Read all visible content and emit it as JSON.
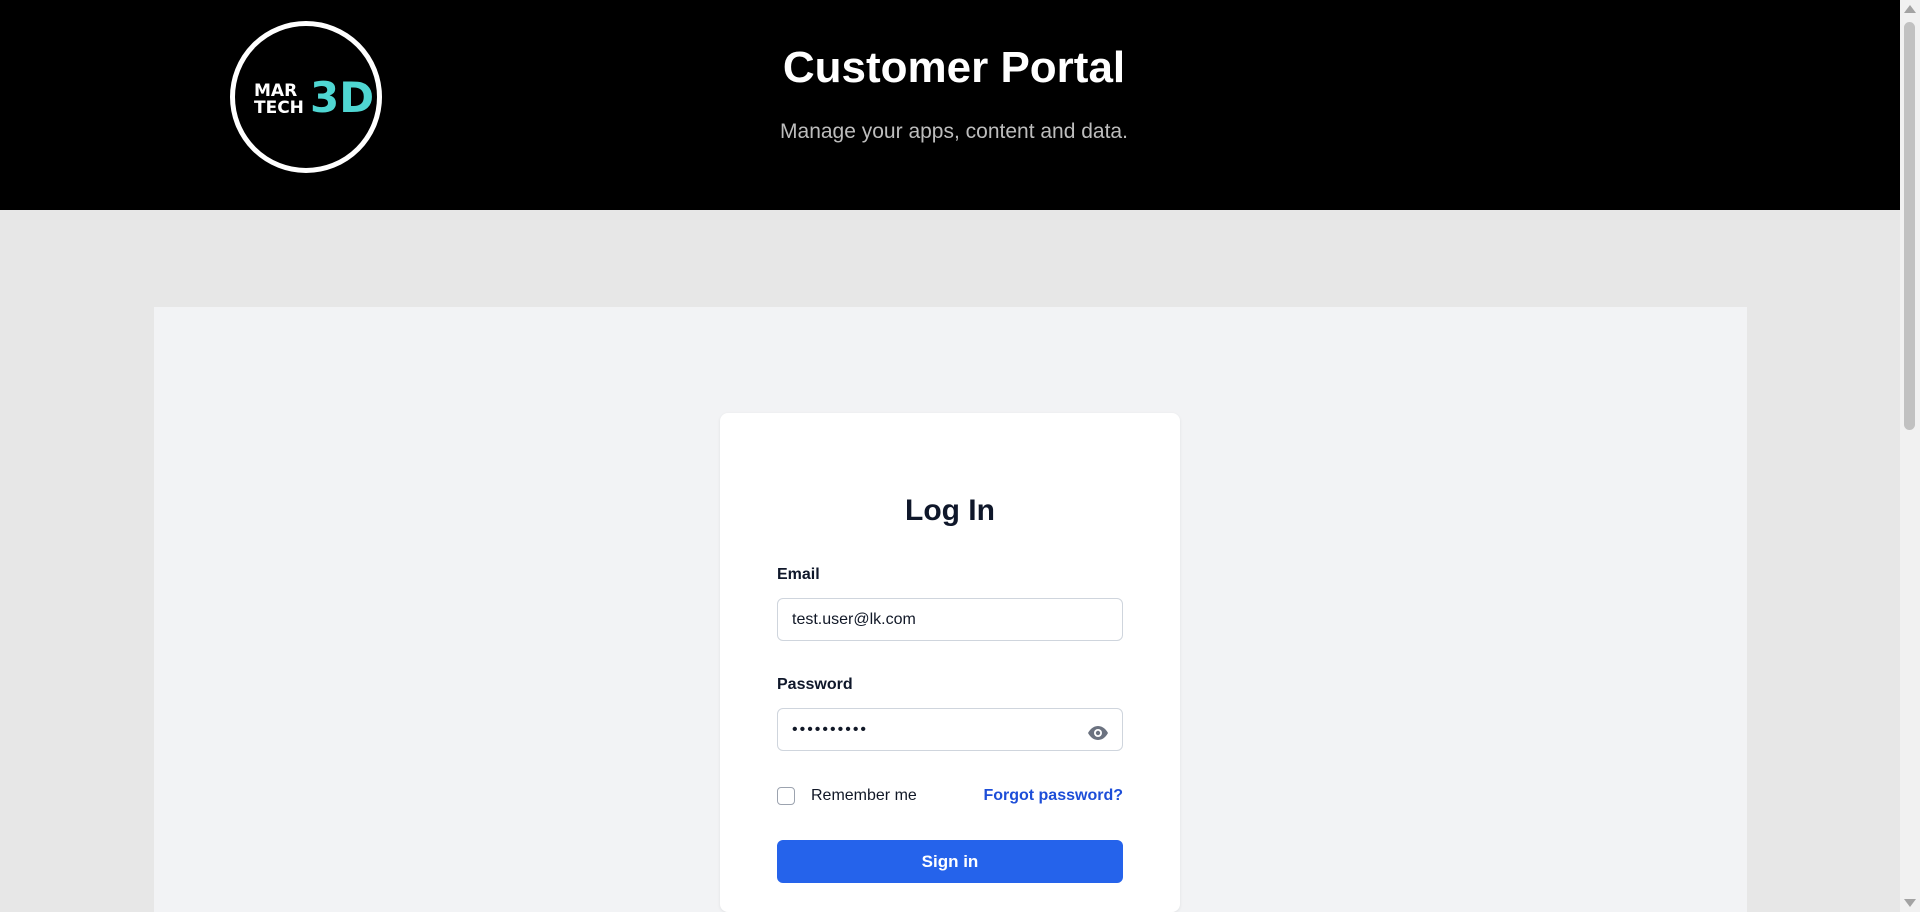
{
  "header": {
    "logo": {
      "line1": "MAR",
      "line2": "TECH",
      "mark": "3D",
      "accent_color": "#4fd6d2"
    },
    "title": "Customer Portal",
    "subtitle": "Manage your apps, content and data."
  },
  "login": {
    "title": "Log In",
    "email": {
      "label": "Email",
      "value": "test.user@lk.com"
    },
    "password": {
      "label": "Password",
      "value": "••••••••••",
      "toggle_icon": "eye-icon"
    },
    "remember_me": {
      "label": "Remember me",
      "checked": false
    },
    "forgot_password": "Forgot password?",
    "submit": "Sign in",
    "button_color": "#2563eb",
    "link_color": "#1d4ed8"
  }
}
